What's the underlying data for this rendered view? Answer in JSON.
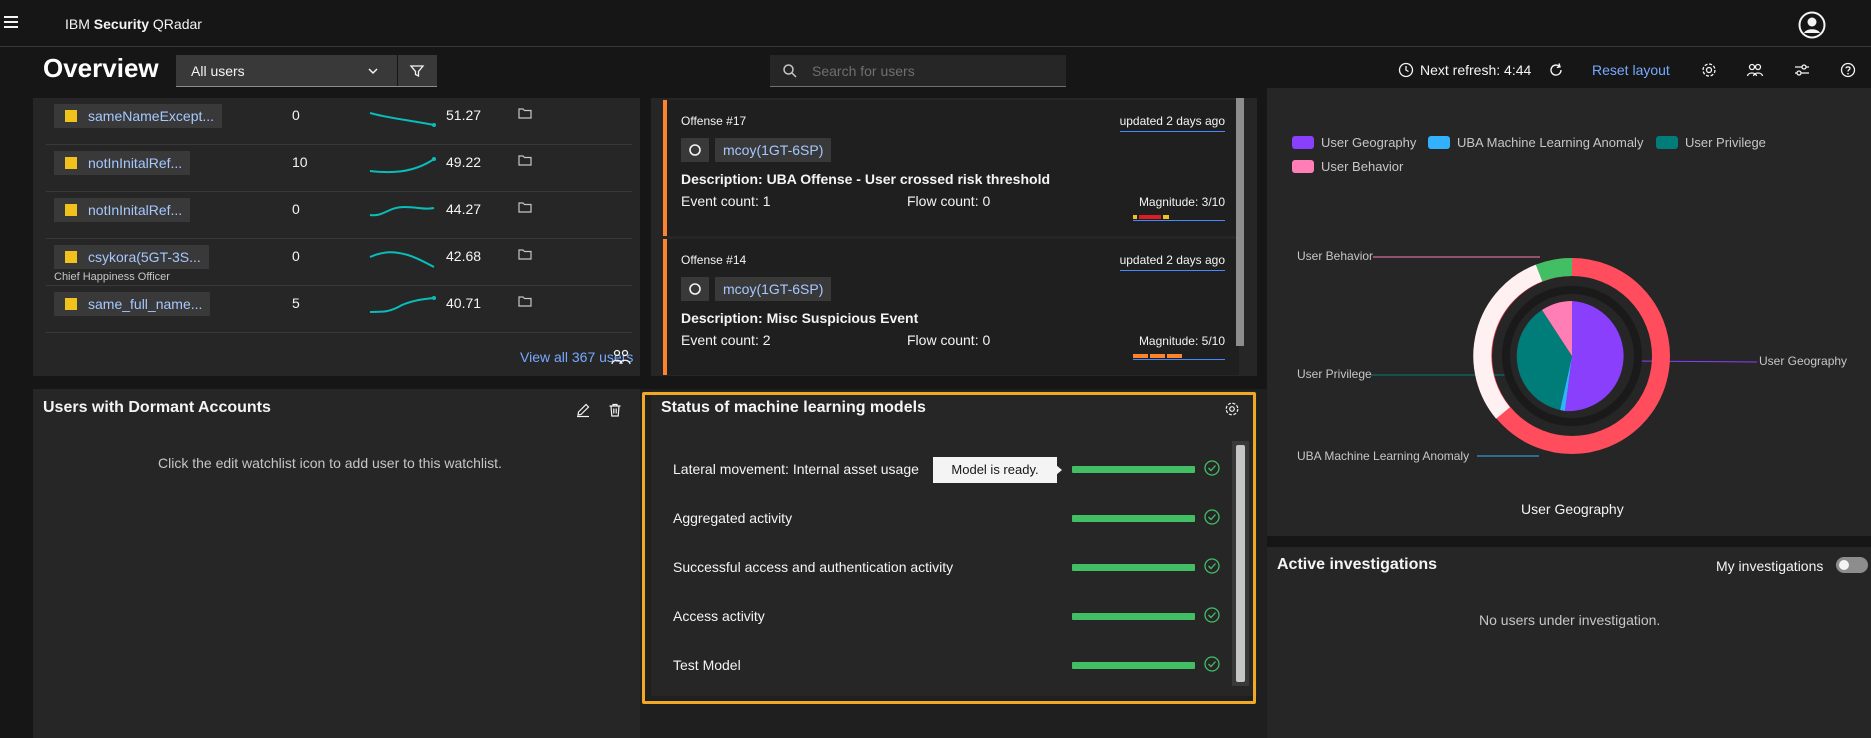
{
  "app": {
    "brand_prefix": "IBM",
    "brand_bold": "Security",
    "brand_suffix": "QRadar"
  },
  "header": {
    "title": "Overview",
    "user_filter": "All users",
    "search_placeholder": "Search for users",
    "next_refresh": "Next refresh: 4:44",
    "reset_layout": "Reset layout"
  },
  "users_panel": {
    "rows": [
      {
        "name": "sameNameExcept...",
        "count": "0",
        "score": "51.27",
        "subtitle": ""
      },
      {
        "name": "notInInitalRef...",
        "count": "10",
        "score": "49.22",
        "subtitle": ""
      },
      {
        "name": "notInInitalRef...",
        "count": "0",
        "score": "44.27",
        "subtitle": ""
      },
      {
        "name": "csykora(5GT-3S...",
        "count": "0",
        "score": "42.68",
        "subtitle": "Chief Happiness Officer"
      },
      {
        "name": "same_full_name...",
        "count": "5",
        "score": "40.71",
        "subtitle": ""
      }
    ],
    "view_all": "View all 367 users"
  },
  "offenses_panel": {
    "offenses": [
      {
        "number": "Offense #17",
        "updated": "updated 2 days ago",
        "user": "mcoy(1GT-6SP)",
        "description": "Description: UBA Offense - User crossed risk threshold",
        "event_count": "Event count: 1",
        "flow_count": "Flow count: 0",
        "magnitude": "Magnitude: 3/10"
      },
      {
        "number": "Offense #14",
        "updated": "updated 2 days ago",
        "user": "mcoy(1GT-6SP)",
        "description": "Description: Misc Suspicious Event",
        "event_count": "Event count: 2",
        "flow_count": "Flow count: 0",
        "magnitude": "Magnitude: 5/10"
      }
    ]
  },
  "risk_panel": {
    "legend": [
      {
        "label": "User Geography",
        "color": "#8a3ffc"
      },
      {
        "label": "UBA Machine Learning Anomaly",
        "color": "#33b1ff"
      },
      {
        "label": "User Privilege",
        "color": "#007d79"
      },
      {
        "label": "User Behavior",
        "color": "#ff7eb6"
      }
    ],
    "callouts": {
      "user_behavior": "User Behavior",
      "user_privilege": "User Privilege",
      "uba_ml": "UBA Machine Learning Anomaly",
      "user_geography": "User Geography"
    },
    "caption": "User Geography"
  },
  "dormant_panel": {
    "title": "Users with Dormant Accounts",
    "empty_message": "Click the edit watchlist icon to add user to this watchlist."
  },
  "ml_panel": {
    "title": "Status of machine learning models",
    "tooltip": "Model is ready.",
    "models": [
      {
        "name": "Lateral movement: Internal asset usage",
        "progress": 1.0
      },
      {
        "name": "Aggregated activity",
        "progress": 1.0
      },
      {
        "name": "Successful access and authentication activity",
        "progress": 1.0
      },
      {
        "name": "Access activity",
        "progress": 1.0
      },
      {
        "name": "Test Model",
        "progress": 1.0
      }
    ],
    "status_color": "#42be65"
  },
  "active_panel": {
    "title": "Active investigations",
    "toggle_label": "My investigations",
    "empty_message": "No users under investigation."
  },
  "colors": {
    "accent_link": "#78a9ff",
    "offense_border": "#ff832b",
    "highlight": "#f1a824",
    "watch_square": "#f1c21b"
  }
}
